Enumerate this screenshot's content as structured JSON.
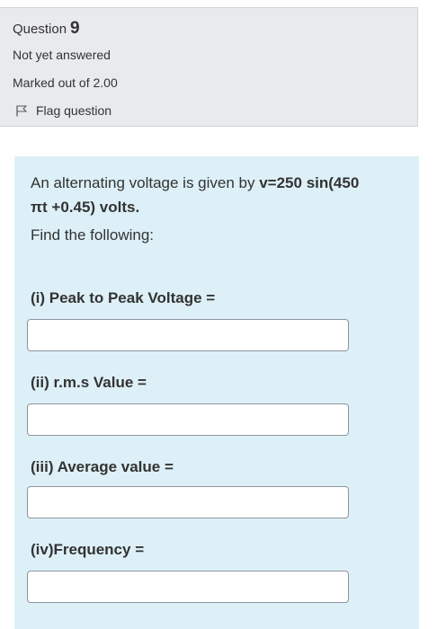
{
  "question": {
    "title": "Question",
    "number": "9",
    "state": "Not yet answered",
    "grade": "Marked out of 2.00",
    "flag_label": "Flag question"
  },
  "content": {
    "intro": "An alternating voltage is given by ",
    "equation_line1": "v=250 sin(450",
    "equation_line2": "πt +0.45) volts.",
    "find": "Find the following:",
    "parts": [
      {
        "label": "(i) Peak to Peak Voltage =",
        "value": ""
      },
      {
        "label": "(ii) r.m.s Value =",
        "value": ""
      },
      {
        "label": "(iii) Average value =",
        "value": ""
      },
      {
        "label": "(iv)Frequency =",
        "value": ""
      }
    ]
  },
  "colors": {
    "info_background": "#e8eaee",
    "content_background": "#ddf0f7",
    "text": "#333333"
  }
}
